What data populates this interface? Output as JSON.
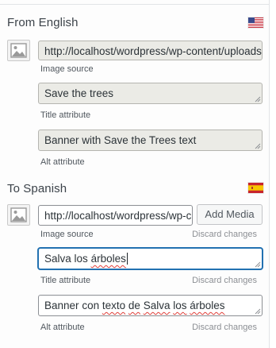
{
  "source": {
    "heading": "From English",
    "flag_icon": "us-flag-icon",
    "image_source_value": "http://localhost/wordpress/wp-content/uploads",
    "image_source_label": "Image source",
    "title_value": "Save the trees",
    "title_label": "Title attribute",
    "alt_value": "Banner with Save the Trees text",
    "alt_label": "Alt attribute"
  },
  "target": {
    "heading": "To Spanish",
    "flag_icon": "spain-flag-icon",
    "image_source_value": "http://localhost/wordpress/wp-content/uploads",
    "add_media_label": "Add Media",
    "image_source_label": "Image source",
    "title_words": [
      "Salva",
      "los",
      "árboles"
    ],
    "title_label": "Title attribute",
    "alt_words": [
      "Banner",
      "con",
      "texto",
      "de",
      "Salva",
      "los",
      "árboles"
    ],
    "alt_label": "Alt attribute",
    "discard_label": "Discard changes"
  },
  "colors": {
    "readonly_bg": "#ebebe6",
    "focus_border": "#2271b1",
    "spellcheck": "#e0403a"
  }
}
